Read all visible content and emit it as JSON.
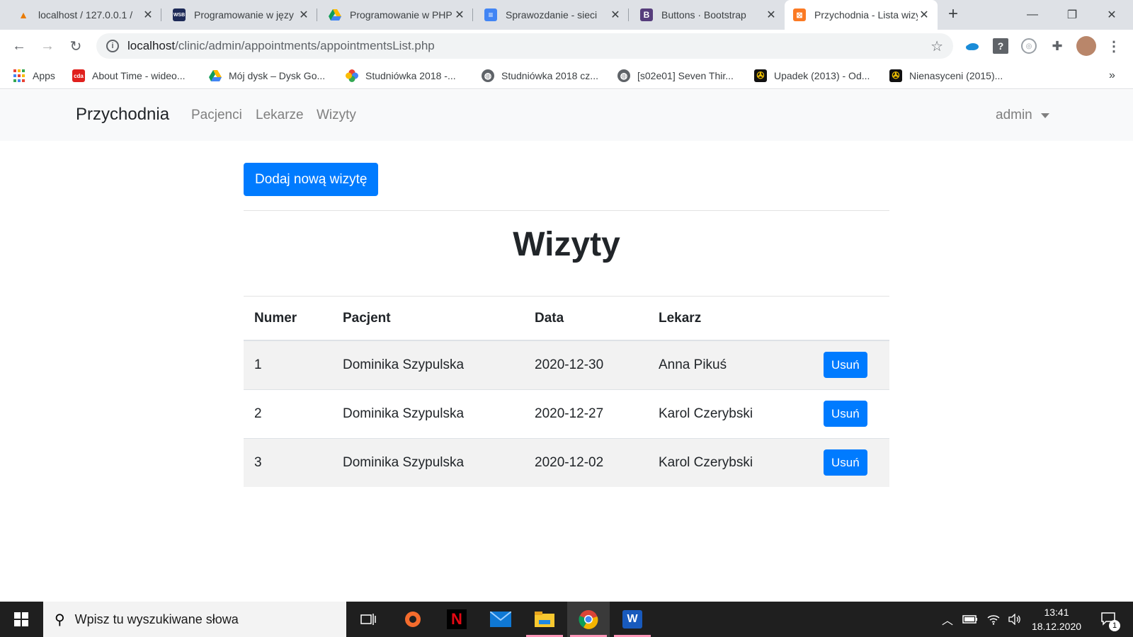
{
  "browser": {
    "tabs": [
      {
        "title": "localhost / 127.0.0.1 / ",
        "icon": "phpmyadmin-icon"
      },
      {
        "title": "Programowanie w języ",
        "icon": "wsb-icon"
      },
      {
        "title": "Programowanie w PHP",
        "icon": "google-drive-icon"
      },
      {
        "title": "Sprawozdanie - sieci ",
        "icon": "google-docs-icon"
      },
      {
        "title": "Buttons · Bootstrap",
        "icon": "bootstrap-icon"
      },
      {
        "title": "Przychodnia - Lista wizyt",
        "icon": "xampp-icon"
      }
    ],
    "url_host": "localhost",
    "url_path": "/clinic/admin/appointments/appointmentsList.php",
    "bookmarks": [
      {
        "label": "Apps",
        "icon": "apps-grid-icon"
      },
      {
        "label": "About Time - wideo...",
        "icon": "cda-icon"
      },
      {
        "label": "Mój dysk – Dysk Go...",
        "icon": "google-drive-icon"
      },
      {
        "label": "Studniówka 2018 -...",
        "icon": "google-photos-icon"
      },
      {
        "label": "Studniówka 2018 cz...",
        "icon": "globe-icon"
      },
      {
        "label": "[s02e01] Seven Thir...",
        "icon": "globe-icon"
      },
      {
        "label": "Upadek (2013) - Od...",
        "icon": "film-reel-icon"
      },
      {
        "label": "Nienasyceni (2015)...",
        "icon": "film-reel-icon"
      }
    ],
    "more_bookmarks": "»"
  },
  "navbar": {
    "brand": "Przychodnia",
    "links": [
      "Pacjenci",
      "Lekarze",
      "Wizyty"
    ],
    "user": "admin"
  },
  "page": {
    "add_button": "Dodaj nową wizytę",
    "title": "Wizyty",
    "table": {
      "headers": [
        "Numer",
        "Pacjent",
        "Data",
        "Lekarz"
      ],
      "rows": [
        {
          "numer": "1",
          "pacjent": "Dominika Szypulska",
          "data": "2020-12-30",
          "lekarz": "Anna Pikuś",
          "action": "Usuń"
        },
        {
          "numer": "2",
          "pacjent": "Dominika Szypulska",
          "data": "2020-12-27",
          "lekarz": "Karol Czerybski",
          "action": "Usuń"
        },
        {
          "numer": "3",
          "pacjent": "Dominika Szypulska",
          "data": "2020-12-02",
          "lekarz": "Karol Czerybski",
          "action": "Usuń"
        }
      ]
    }
  },
  "taskbar": {
    "search_placeholder": "Wpisz tu wyszukiwane słowa",
    "time": "13:41",
    "date": "18.12.2020",
    "notification_count": "1"
  },
  "colors": {
    "primary": "#007bff",
    "navbar_bg": "#f8f9fa",
    "tabstrip_bg": "#dee1e6",
    "taskbar_bg": "#1f1f1f"
  }
}
